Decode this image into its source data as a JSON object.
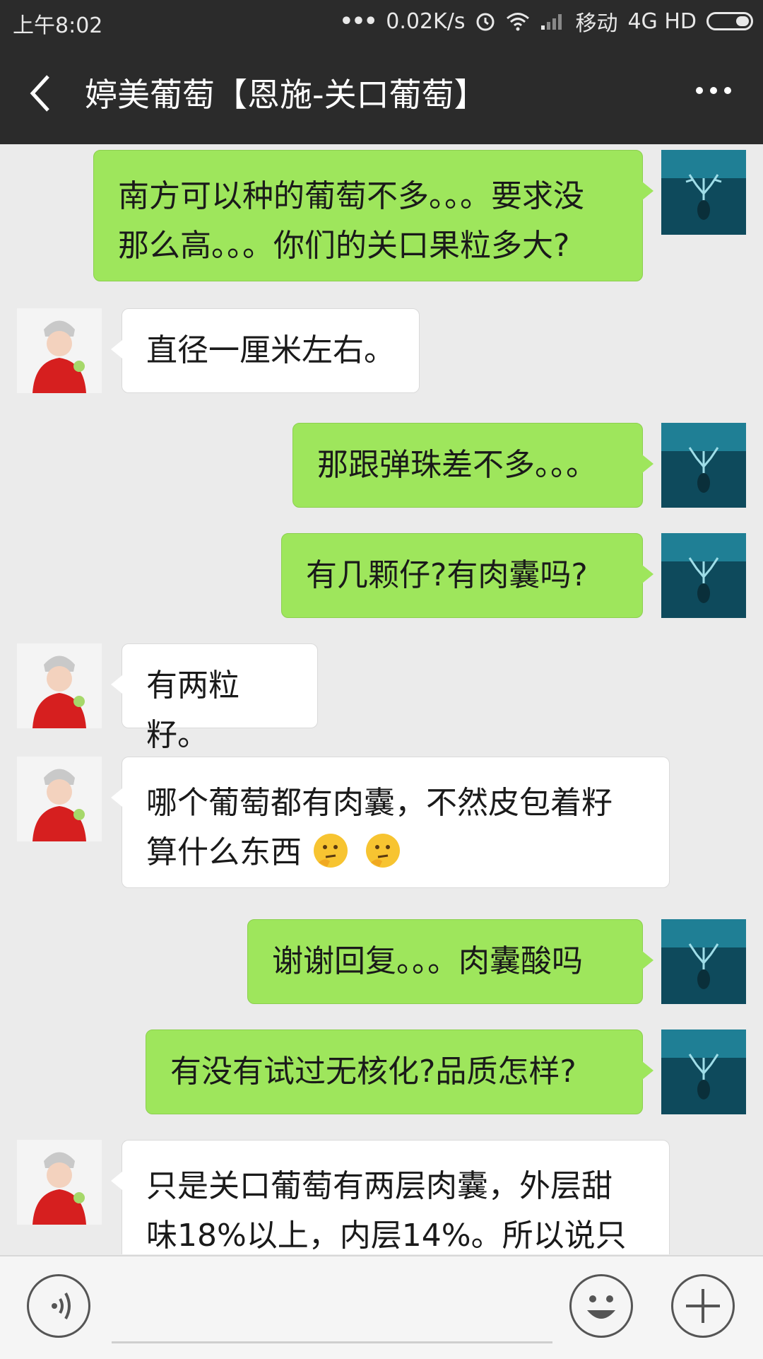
{
  "status_bar": {
    "time": "上午8:02",
    "speed": "0.02K/s",
    "carrier": "移动",
    "network": "4G HD"
  },
  "nav": {
    "title": "婷美葡萄【恩施-关口葡萄】"
  },
  "messages": [
    {
      "from": "me",
      "lines": [
        "南方可以种的葡萄不多。。。要求没",
        "那么高。。。你们的关口果粒多大?"
      ]
    },
    {
      "from": "them",
      "lines": [
        "直径一厘米左右。"
      ]
    },
    {
      "from": "me",
      "lines": [
        "那跟弹珠差不多。。。"
      ]
    },
    {
      "from": "me",
      "lines": [
        "有几颗仔?有肉囊吗?"
      ]
    },
    {
      "from": "them",
      "lines": [
        "有两粒籽。"
      ]
    },
    {
      "from": "them",
      "lines": [
        "哪个葡萄都有肉囊，不然皮包着籽",
        "算什么东西"
      ],
      "emoji": "thinking-face"
    },
    {
      "from": "me",
      "lines": [
        "谢谢回复。。。肉囊酸吗"
      ]
    },
    {
      "from": "me",
      "lines": [
        "有没有试过无核化?品质怎样?"
      ]
    },
    {
      "from": "them",
      "lines": [
        "只是关口葡萄有两层肉囊，外层甜",
        "味18%以上，内层14%。所以说只"
      ]
    }
  ],
  "input": {
    "placeholder": ""
  },
  "colors": {
    "my_bubble": "#9ee65c",
    "their_bubble": "#ffffff",
    "bar": "#2b2b2b",
    "background": "#ebebeb"
  }
}
